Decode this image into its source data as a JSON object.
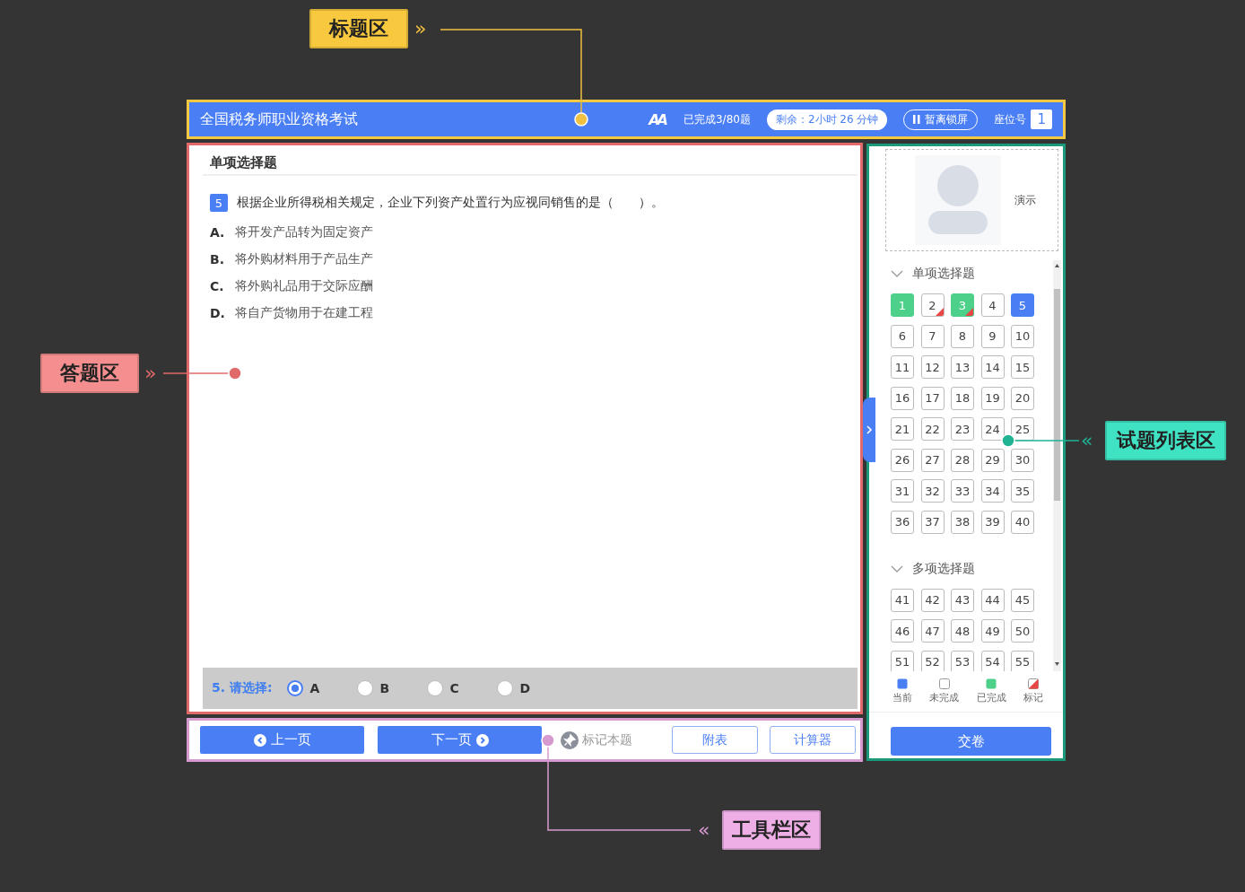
{
  "annotations": [
    {
      "label": "标题区",
      "arrow": "»",
      "color": "#f8c93e"
    },
    {
      "label": "答题区",
      "arrow": "»",
      "color": "#f58f8f"
    },
    {
      "label": "试题列表区",
      "arrow": "«",
      "color": "#3fe3c4"
    },
    {
      "label": "工具栏区",
      "arrow": "«",
      "color": "#eeaee6"
    }
  ],
  "header": {
    "title": "全国税务师职业资格考试",
    "font_button": "AA",
    "progress": "已完成3/80题",
    "timer": "剩余：2小时 26 分钟",
    "pause": "暂离锁屏",
    "seat_label": "座位号",
    "seat_number": "1"
  },
  "answer_area": {
    "section_title": "单项选择题",
    "question": {
      "number": "5",
      "text": "根据企业所得税相关规定，企业下列资产处置行为应视同销售的是（　　）。"
    },
    "options": [
      {
        "letter": "A.",
        "text": "将开发产品转为固定资产"
      },
      {
        "letter": "B.",
        "text": "将外购材料用于产品生产"
      },
      {
        "letter": "C.",
        "text": "将外购礼品用于交际应酬"
      },
      {
        "letter": "D.",
        "text": "将自产货物用于在建工程"
      }
    ],
    "answer_bar": {
      "prompt": "5. 请选择:",
      "choices": [
        {
          "label": "A",
          "selected": true
        },
        {
          "label": "B",
          "selected": false
        },
        {
          "label": "C",
          "selected": false
        },
        {
          "label": "D",
          "selected": false
        }
      ]
    }
  },
  "toolbar": {
    "prev": "上一页",
    "next": "下一页",
    "mark": "标记本题",
    "appendix": "附表",
    "calculator": "计算器"
  },
  "sidebar": {
    "candidate": "演示",
    "groups": [
      {
        "title": "单项选择题",
        "expanded": true,
        "items": [
          {
            "number": "1",
            "selected": false,
            "completed": true,
            "marked": false
          },
          {
            "number": "2",
            "selected": false,
            "completed": false,
            "marked": true
          },
          {
            "number": "3",
            "selected": false,
            "completed": true,
            "marked": true
          },
          {
            "number": "4",
            "selected": false,
            "completed": false,
            "marked": false
          },
          {
            "number": "5",
            "selected": true,
            "completed": false,
            "marked": false
          },
          {
            "number": "6",
            "selected": false,
            "completed": false,
            "marked": false
          },
          {
            "number": "7",
            "selected": false,
            "completed": false,
            "marked": false
          },
          {
            "number": "8",
            "selected": false,
            "completed": false,
            "marked": false
          },
          {
            "number": "9",
            "selected": false,
            "completed": false,
            "marked": false
          },
          {
            "number": "10",
            "selected": false,
            "completed": false,
            "marked": false
          },
          {
            "number": "11",
            "selected": false,
            "completed": false,
            "marked": false
          },
          {
            "number": "12",
            "selected": false,
            "completed": false,
            "marked": false
          },
          {
            "number": "13",
            "selected": false,
            "completed": false,
            "marked": false
          },
          {
            "number": "14",
            "selected": false,
            "completed": false,
            "marked": false
          },
          {
            "number": "15",
            "selected": false,
            "completed": false,
            "marked": false
          },
          {
            "number": "16",
            "selected": false,
            "completed": false,
            "marked": false
          },
          {
            "number": "17",
            "selected": false,
            "completed": false,
            "marked": false
          },
          {
            "number": "18",
            "selected": false,
            "completed": false,
            "marked": false
          },
          {
            "number": "19",
            "selected": false,
            "completed": false,
            "marked": false
          },
          {
            "number": "20",
            "selected": false,
            "completed": false,
            "marked": false
          },
          {
            "number": "21",
            "selected": false,
            "completed": false,
            "marked": false
          },
          {
            "number": "22",
            "selected": false,
            "completed": false,
            "marked": false
          },
          {
            "number": "23",
            "selected": false,
            "completed": false,
            "marked": false
          },
          {
            "number": "24",
            "selected": false,
            "completed": false,
            "marked": false
          },
          {
            "number": "25",
            "selected": false,
            "completed": false,
            "marked": false
          },
          {
            "number": "26",
            "selected": false,
            "completed": false,
            "marked": false
          },
          {
            "number": "27",
            "selected": false,
            "completed": false,
            "marked": false
          },
          {
            "number": "28",
            "selected": false,
            "completed": false,
            "marked": false
          },
          {
            "number": "29",
            "selected": false,
            "completed": false,
            "marked": false
          },
          {
            "number": "30",
            "selected": false,
            "completed": false,
            "marked": false
          },
          {
            "number": "31",
            "selected": false,
            "completed": false,
            "marked": false
          },
          {
            "number": "32",
            "selected": false,
            "completed": false,
            "marked": false
          },
          {
            "number": "33",
            "selected": false,
            "completed": false,
            "marked": false
          },
          {
            "number": "34",
            "selected": false,
            "completed": false,
            "marked": false
          },
          {
            "number": "35",
            "selected": false,
            "completed": false,
            "marked": false
          },
          {
            "number": "36",
            "selected": false,
            "completed": false,
            "marked": false
          },
          {
            "number": "37",
            "selected": false,
            "completed": false,
            "marked": false
          },
          {
            "number": "38",
            "selected": false,
            "completed": false,
            "marked": false
          },
          {
            "number": "39",
            "selected": false,
            "completed": false,
            "marked": false
          },
          {
            "number": "40",
            "selected": false,
            "completed": false,
            "marked": false
          }
        ]
      },
      {
        "title": "多项选择题",
        "expanded": true,
        "items": [
          {
            "number": "41",
            "selected": false,
            "completed": false,
            "marked": false
          },
          {
            "number": "42",
            "selected": false,
            "completed": false,
            "marked": false
          },
          {
            "number": "43",
            "selected": false,
            "completed": false,
            "marked": false
          },
          {
            "number": "44",
            "selected": false,
            "completed": false,
            "marked": false
          },
          {
            "number": "45",
            "selected": false,
            "completed": false,
            "marked": false
          },
          {
            "number": "46",
            "selected": false,
            "completed": false,
            "marked": false
          },
          {
            "number": "47",
            "selected": false,
            "completed": false,
            "marked": false
          },
          {
            "number": "48",
            "selected": false,
            "completed": false,
            "marked": false
          },
          {
            "number": "49",
            "selected": false,
            "completed": false,
            "marked": false
          },
          {
            "number": "50",
            "selected": false,
            "completed": false,
            "marked": false
          },
          {
            "number": "51",
            "selected": false,
            "completed": false,
            "marked": false
          },
          {
            "number": "52",
            "selected": false,
            "completed": false,
            "marked": false
          },
          {
            "number": "53",
            "selected": false,
            "completed": false,
            "marked": false
          },
          {
            "number": "54",
            "selected": false,
            "completed": false,
            "marked": false
          },
          {
            "number": "55",
            "selected": false,
            "completed": false,
            "marked": false
          }
        ]
      }
    ],
    "legend": [
      {
        "label": "当前",
        "kind": "current"
      },
      {
        "label": "未完成",
        "kind": "todo"
      },
      {
        "label": "已完成",
        "kind": "done"
      },
      {
        "label": "标记",
        "kind": "marked"
      }
    ],
    "submit": "交卷"
  }
}
